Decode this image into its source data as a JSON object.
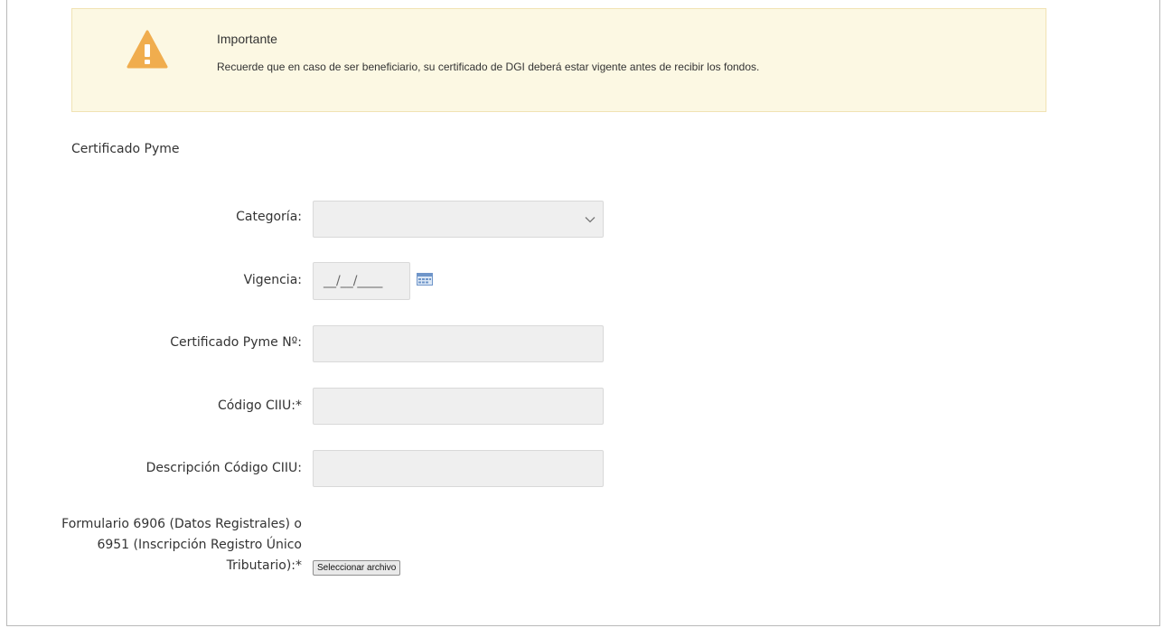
{
  "alert": {
    "icon": "warning-icon",
    "title": "Importante",
    "message": "Recuerde que en caso de ser beneficiario, su certificado de DGI deberá estar vigente antes de recibir los fondos."
  },
  "section_title": "Certificado Pyme",
  "form": {
    "categoria_label": "Categoría:",
    "categoria_value": "",
    "vigencia_label": "Vigencia:",
    "vigencia_value": "__/__/____",
    "calendar_icon": "calendar-icon",
    "certificado_label": "Certificado Pyme Nº:",
    "certificado_value": "",
    "ciiu_label": "Código CIIU:*",
    "ciiu_value": "",
    "descripcion_label": "Descripción Código CIIU:",
    "descripcion_value": "",
    "formulario_label": "Formulario 6906 (Datos Registrales) o 6951 (Inscripción Registro Único Tributario):*",
    "file_button_label": "Seleccionar archivo"
  },
  "colors": {
    "alert_bg": "#fcf8e3",
    "warning": "#f0ad4e",
    "field_bg": "#efefef"
  }
}
